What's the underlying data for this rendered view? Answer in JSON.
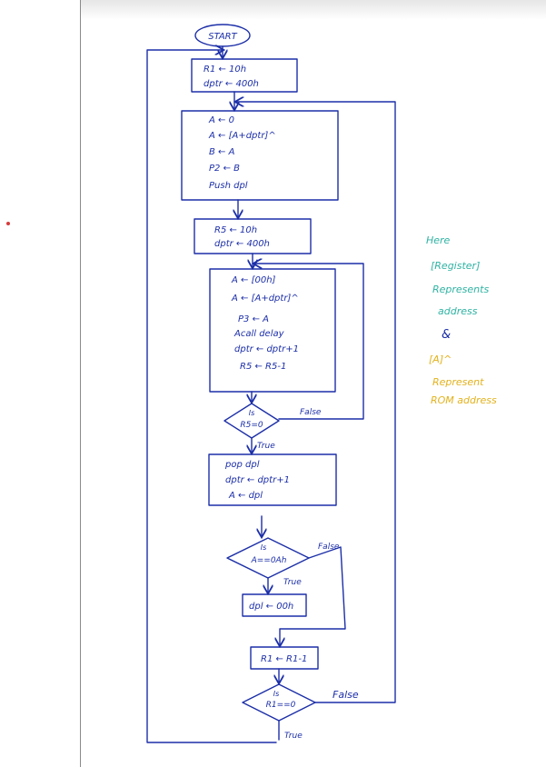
{
  "colors": {
    "ink": "#1c2fa8",
    "note_green": "#2fb3a3",
    "note_yellow": "#e3b21d",
    "margin_dot": "#d63b3b"
  },
  "flowchart": {
    "start": "START",
    "init_block": [
      "R1 ← 10h",
      "dptr ← 400h"
    ],
    "block2": [
      "A ← 0",
      "A ← [A+dptr]^",
      "B ← A",
      "P2 ← B",
      "Push dpl"
    ],
    "block3": [
      "R5 ← 10h",
      "dptr ← 400h"
    ],
    "block4": [
      "A ← [00h]",
      "A ← [A+dptr]^",
      "P3 ← A",
      "Acall delay",
      "dptr ← dptr+1",
      "R5 ← R5-1"
    ],
    "decision1": {
      "is": "Is",
      "cond": "R5=0",
      "false": "False",
      "true": "True"
    },
    "block5": [
      "pop dpl",
      "dptr ← dptr+1",
      "A ← dpl"
    ],
    "decision2": {
      "is": "Is",
      "cond": "A==0Ah",
      "false": "False",
      "true": "True"
    },
    "block6": "dpl ← 00h",
    "block7": "R1 ← R1-1",
    "decision3": {
      "is": "Is",
      "cond": "R1==0",
      "false": "False",
      "true": "True"
    }
  },
  "notes": {
    "green": [
      "Here",
      "[Register]",
      "Represents",
      "address"
    ],
    "amp": "&",
    "yellow": [
      "[A]^",
      "Represent",
      "ROM address"
    ]
  }
}
